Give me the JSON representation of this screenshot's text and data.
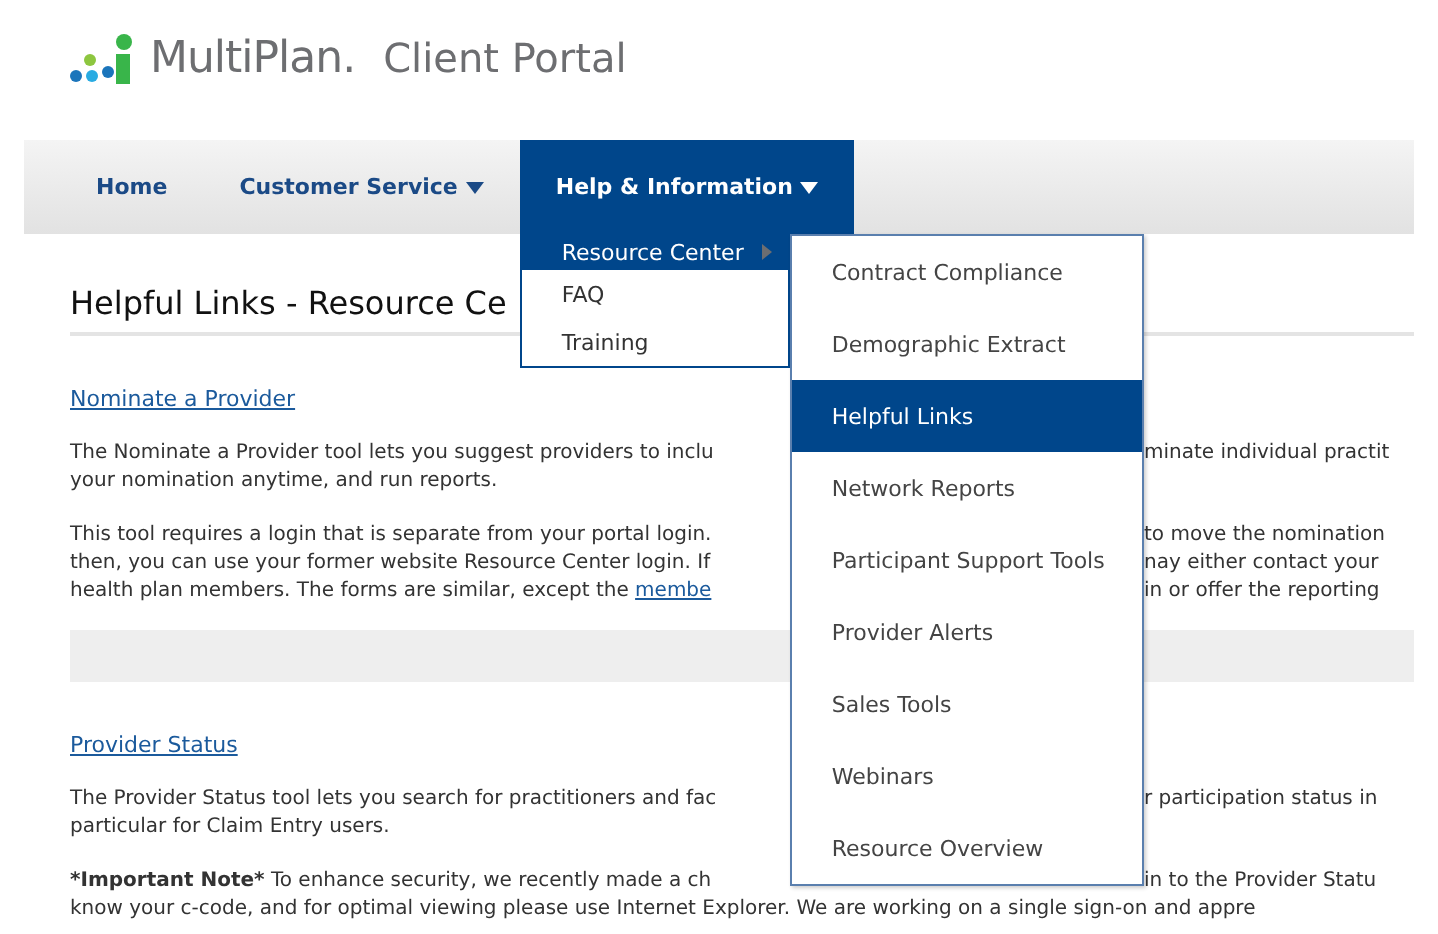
{
  "logo": {
    "brand": "MultiPlan.",
    "product": "Client Portal"
  },
  "nav": [
    {
      "label": "Home",
      "has_caret": false,
      "selected": false
    },
    {
      "label": "Customer Service",
      "has_caret": true,
      "selected": false
    },
    {
      "label": "Help & Information",
      "has_caret": true,
      "selected": true
    }
  ],
  "dropdown": [
    {
      "label": "Resource Center",
      "selected": true,
      "has_submenu": true
    },
    {
      "label": "FAQ",
      "selected": false,
      "has_submenu": false
    },
    {
      "label": "Training",
      "selected": false,
      "has_submenu": false
    }
  ],
  "submenu": [
    {
      "label": "Contract Compliance",
      "selected": false
    },
    {
      "label": "Demographic Extract",
      "selected": false
    },
    {
      "label": "Helpful Links",
      "selected": true
    },
    {
      "label": "Network Reports",
      "selected": false
    },
    {
      "label": "Participant Support Tools",
      "selected": false
    },
    {
      "label": "Provider Alerts",
      "selected": false
    },
    {
      "label": "Sales Tools",
      "selected": false
    },
    {
      "label": "Webinars",
      "selected": false
    },
    {
      "label": "Resource Overview",
      "selected": false
    }
  ],
  "page_title": "Helpful Links - Resource Ce",
  "sections": [
    {
      "link": "Nominate a Provider",
      "bar": true,
      "paragraphs": [
        [
          {
            "left": "The Nominate a Provider tool lets you suggest providers to inclu",
            "right": "minate individual practit"
          },
          {
            "left": "your nomination anytime, and run reports."
          }
        ],
        [
          {
            "left": "This tool requires a login that is separate from your portal login.",
            "right": "to move the nomination"
          },
          {
            "left": "then, you can use your former website Resource Center login. If",
            "right": "nay either contact your"
          },
          {
            "left": "health plan members. The forms are similar, except the ",
            "left_link": "membe",
            "right": "in or offer the reporting"
          }
        ]
      ]
    },
    {
      "link": "Provider Status",
      "bar": false,
      "paragraphs": [
        [
          {
            "left": "The Provider Status tool lets you search for practitioners and fac",
            "right": "r participation status in"
          },
          {
            "left": "particular for Claim Entry users."
          }
        ],
        [
          {
            "lead": "*Important Note*",
            "left": " To enhance security, we recently made a ch",
            "right": "in to the Provider Statu"
          },
          {
            "full": "know your c-code, and for optimal viewing please use Internet Explorer. We are working on a single sign-on and appre"
          }
        ]
      ]
    }
  ]
}
